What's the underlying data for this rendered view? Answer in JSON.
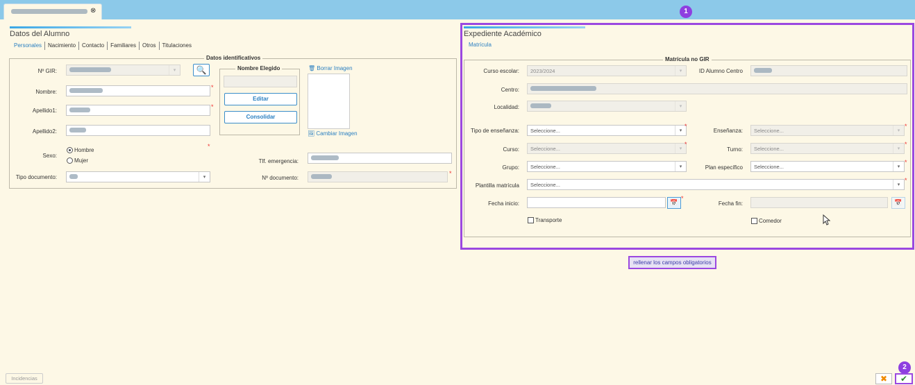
{
  "doc_tab": {
    "close_icon": "close-icon"
  },
  "badges": {
    "one": "1",
    "two": "2"
  },
  "left": {
    "title": "Datos del Alumno",
    "tabs": [
      "Personales",
      "Nacimiento",
      "Contacto",
      "Familiares",
      "Otros",
      "Titulaciones"
    ],
    "legend": "Datos identificativos",
    "labels": {
      "gir": "Nº GIR:",
      "nombre": "Nombre:",
      "apellido1": "Apellido1:",
      "apellido2": "Apellido2:",
      "sexo": "Sexo:",
      "hombre": "Hombre",
      "mujer": "Mujer",
      "tlf": "Tlf. emergencia:",
      "tipo_doc": "Tipo documento:",
      "num_doc": "Nº documento:"
    },
    "nombre_elegido": {
      "legend": "Nombre Elegido",
      "edit": "Editar",
      "consolidar": "Consolidar"
    },
    "image": {
      "borrar": "Borrar Imagen",
      "cambiar": "Cambiar Imagen"
    }
  },
  "right": {
    "title": "Expediente Académico",
    "tab": "Matrícula",
    "legend": "Matrícula no GIR",
    "labels": {
      "curso_escolar": "Curso escolar:",
      "id_alumno": "ID Alumno Centro",
      "centro": "Centro:",
      "localidad": "Localidad:",
      "tipo_ensenanza": "Tipo de enseñanza:",
      "ensenanza": "Enseñanza:",
      "curso": "Curso:",
      "turno": "Turno:",
      "grupo": "Grupo:",
      "plan": "Plan específico",
      "plantilla": "Plantilla matrícula",
      "fecha_inicio": "Fecha inicio:",
      "fecha_fin": "Fecha fin:",
      "transporte": "Transporte",
      "comedor": "Comedor"
    },
    "values": {
      "curso_escolar": "2023/2024",
      "placeholder": "Seleccione..."
    }
  },
  "tooltip": "rellenar los campos obligatorios",
  "footer": {
    "incidencias": "Incidencias"
  }
}
